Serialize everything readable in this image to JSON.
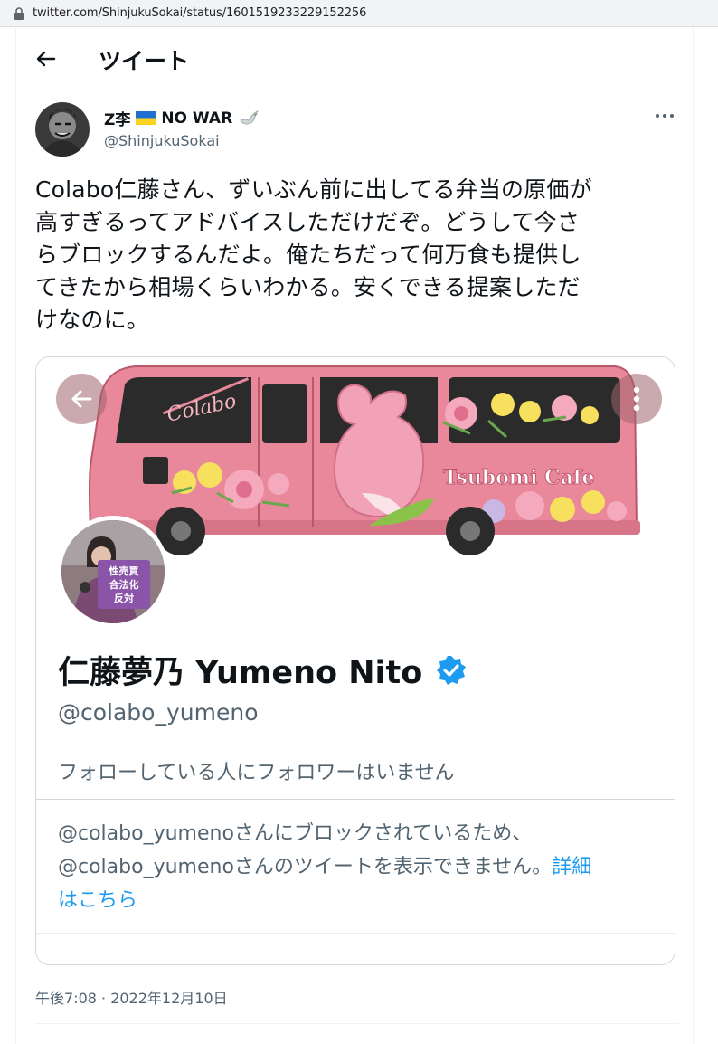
{
  "browser": {
    "url": "twitter.com/ShinjukuSokai/status/1601519233229152256"
  },
  "header": {
    "title": "ツイート"
  },
  "tweet": {
    "author_name": "Z李",
    "author_suffix": "NO WAR",
    "author_handle": "@ShinjukuSokai",
    "text_lines": [
      "Colabo仁藤さん、ずいぶん前に出してる弁当の原価が",
      "高すぎるってアドバイスしただけだぞ。どうして今さ",
      "らブロックするんだよ。俺たちだって何万食も提供し",
      "てきたから相場くらいわかる。安くできる提案しただ",
      "けなのに。"
    ],
    "timestamp": "午後7:08 · 2022年12月10日"
  },
  "card": {
    "banner_logo": "Colabo",
    "banner_cafe": "Tsubomi Cafe",
    "sign_lines": [
      "性売買",
      "合法化",
      "反対"
    ],
    "name": "仁藤夢乃 Yumeno Nito",
    "handle": "@colabo_yumeno",
    "followers_note": "フォローしている人にフォロワーはいません",
    "blocked_line1": "@colabo_yumenoさんにブロックされているため、",
    "blocked_line2": "@colabo_yumenoさんのツイートを表示できません。",
    "link_part1": "詳細",
    "link_part2": "はこちら"
  },
  "colors": {
    "accent": "#1d9bf0",
    "bus_pink": "#e8889a",
    "bus_dark": "#2b2b2b"
  },
  "icons": [
    "lock-icon",
    "back-arrow-icon",
    "more-icon",
    "verified-icon",
    "dove-icon",
    "ukraine-flag-icon"
  ]
}
